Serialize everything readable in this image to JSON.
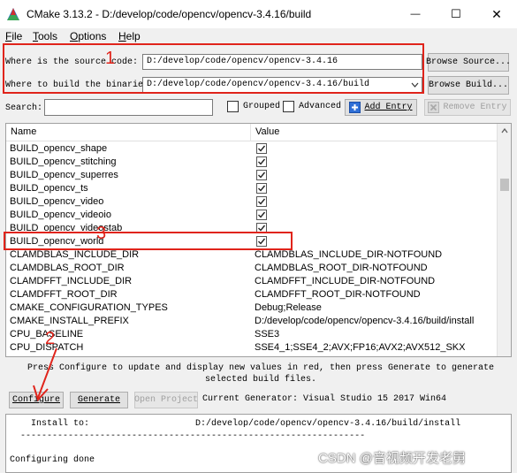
{
  "window": {
    "title": "CMake 3.13.2 - D:/develop/code/opencv/opencv-3.4.16/build",
    "minimize_glyph": "—",
    "maximize_glyph": "☐",
    "close_glyph": "✕"
  },
  "menu": [
    {
      "label": "File",
      "ul": "F",
      "rest": "ile"
    },
    {
      "label": "Tools",
      "ul": "T",
      "rest": "ools"
    },
    {
      "label": "Options",
      "ul": "O",
      "rest": "ptions"
    },
    {
      "label": "Help",
      "ul": "H",
      "rest": "elp"
    }
  ],
  "source": {
    "label": "Where is the source code:",
    "value": "D:/develop/code/opencv/opencv-3.4.16",
    "browse_label": "Browse Source..."
  },
  "build": {
    "label": "Where to build the binaries:",
    "value": "D:/develop/code/opencv/opencv-3.4.16/build",
    "browse_label": "Browse Build..."
  },
  "search": {
    "label": "Search:",
    "value": ""
  },
  "options": {
    "grouped_label": "Grouped",
    "advanced_label": "Advanced",
    "add_entry_label": "Add Entry",
    "remove_entry_label": "Remove Entry"
  },
  "table": {
    "headers": {
      "name": "Name",
      "value": "Value"
    },
    "rows": [
      {
        "name": "BUILD_opencv_shape",
        "type": "bool",
        "value": true
      },
      {
        "name": "BUILD_opencv_stitching",
        "type": "bool",
        "value": true
      },
      {
        "name": "BUILD_opencv_superres",
        "type": "bool",
        "value": true
      },
      {
        "name": "BUILD_opencv_ts",
        "type": "bool",
        "value": true
      },
      {
        "name": "BUILD_opencv_video",
        "type": "bool",
        "value": true
      },
      {
        "name": "BUILD_opencv_videoio",
        "type": "bool",
        "value": true
      },
      {
        "name": "BUILD_opencv_videostab",
        "type": "bool",
        "value": true
      },
      {
        "name": "BUILD_opencv_world",
        "type": "bool",
        "value": true
      },
      {
        "name": "CLAMDBLAS_INCLUDE_DIR",
        "type": "text",
        "value": "CLAMDBLAS_INCLUDE_DIR-NOTFOUND"
      },
      {
        "name": "CLAMDBLAS_ROOT_DIR",
        "type": "text",
        "value": "CLAMDBLAS_ROOT_DIR-NOTFOUND"
      },
      {
        "name": "CLAMDFFT_INCLUDE_DIR",
        "type": "text",
        "value": "CLAMDFFT_INCLUDE_DIR-NOTFOUND"
      },
      {
        "name": "CLAMDFFT_ROOT_DIR",
        "type": "text",
        "value": "CLAMDFFT_ROOT_DIR-NOTFOUND"
      },
      {
        "name": "CMAKE_CONFIGURATION_TYPES",
        "type": "text",
        "value": "Debug;Release"
      },
      {
        "name": "CMAKE_INSTALL_PREFIX",
        "type": "text",
        "value": "D:/develop/code/opencv/opencv-3.4.16/build/install"
      },
      {
        "name": "CPU_BASELINE",
        "type": "text",
        "value": "SSE3"
      },
      {
        "name": "CPU_DISPATCH",
        "type": "text",
        "value": "SSE4_1;SSE4_2;AVX;FP16;AVX2;AVX512_SKX"
      }
    ]
  },
  "info_text": "Press Configure to update and display new values in red, then press Generate to generate selected build files.",
  "buttons": {
    "configure": "Configure",
    "generate": "Generate",
    "open_project": "Open Project"
  },
  "generator_label": "Current Generator: Visual Studio 15 2017 Win64",
  "output": {
    "lines": [
      "    Install to:                    D:/develop/code/opencv/opencv-3.4.16/build/install",
      "  -----------------------------------------------------------------",
      "",
      "Configuring done"
    ]
  },
  "annotations": {
    "marker_1": "1",
    "marker_2": "2",
    "marker_3": "3",
    "color": "#e0241b"
  },
  "watermark": "CSDN @音视频开发老舅"
}
